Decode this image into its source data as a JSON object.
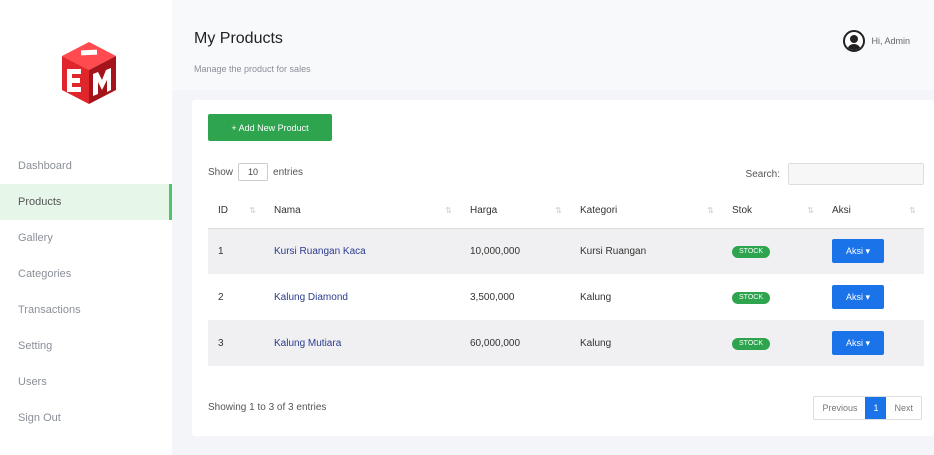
{
  "sidebar": {
    "items": [
      {
        "label": "Dashboard",
        "active": false
      },
      {
        "label": "Products",
        "active": true
      },
      {
        "label": "Gallery",
        "active": false
      },
      {
        "label": "Categories",
        "active": false
      },
      {
        "label": "Transactions",
        "active": false
      },
      {
        "label": "Setting",
        "active": false
      },
      {
        "label": "Users",
        "active": false
      },
      {
        "label": "Sign Out",
        "active": false
      }
    ]
  },
  "header": {
    "title": "My Products",
    "breadcrumb": "Manage the product for sales",
    "user_label": "Hi, Admin"
  },
  "main": {
    "add_button": "+ Add New Product",
    "show_label": "Show",
    "entries_value": "10",
    "entries_label": "entries",
    "search_label": "Search:",
    "search_value": "",
    "columns": [
      "ID",
      "Nama",
      "Harga",
      "Kategori",
      "Stok",
      "Aksi"
    ],
    "rows": [
      {
        "id": "1",
        "nama": "Kursi Ruangan Kaca",
        "harga": "10,000,000",
        "kategori": "Kursi Ruangan",
        "stok": "STOCK",
        "aksi": "Aksi ▾"
      },
      {
        "id": "2",
        "nama": "Kalung Diamond",
        "harga": "3,500,000",
        "kategori": "Kalung",
        "stok": "STOCK",
        "aksi": "Aksi ▾"
      },
      {
        "id": "3",
        "nama": "Kalung Mutiara",
        "harga": "60,000,000",
        "kategori": "Kalung",
        "stok": "STOCK",
        "aksi": "Aksi ▾"
      }
    ],
    "info": "Showing 1 to 3 of 3 entries",
    "pagination": {
      "previous": "Previous",
      "current": "1",
      "next": "Next"
    }
  },
  "colors": {
    "accent": "#2ea44f",
    "primary": "#1a73e8",
    "logo_red": "#e0252b",
    "logo_dark": "#5a0e12"
  }
}
